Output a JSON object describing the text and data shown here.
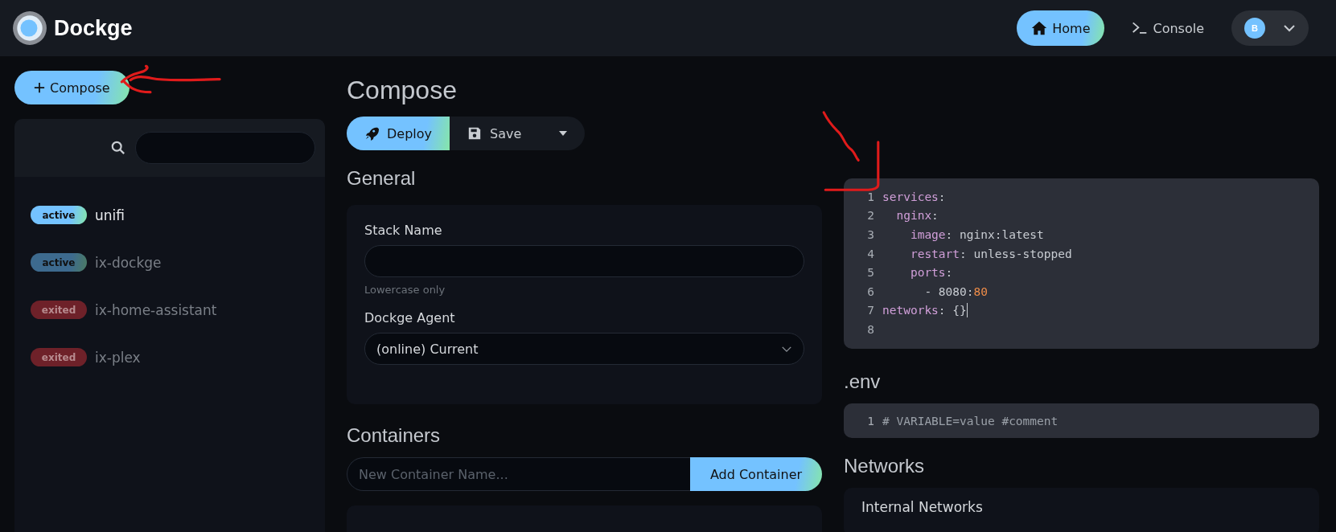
{
  "header": {
    "brand": "Dockge",
    "nav": [
      {
        "label": "Home",
        "selected": true
      },
      {
        "label": "Console",
        "selected": false
      }
    ],
    "profile": {
      "initial": "B"
    }
  },
  "sidebar": {
    "compose_button": "Compose",
    "stacks": [
      {
        "status": "active",
        "kind": "active",
        "name": "unifi",
        "dimmed": false
      },
      {
        "status": "active",
        "kind": "active",
        "name": "ix-dockge",
        "dimmed": true
      },
      {
        "status": "exited",
        "kind": "exited",
        "name": "ix-home-assistant",
        "dimmed": true
      },
      {
        "status": "exited",
        "kind": "exited",
        "name": "ix-plex",
        "dimmed": true
      }
    ]
  },
  "page": {
    "title": "Compose",
    "actions": {
      "deploy": "Deploy",
      "save": "Save"
    },
    "general": {
      "heading": "General",
      "stack_name": {
        "label": "Stack Name",
        "hint": "Lowercase only"
      },
      "agent": {
        "label": "Dockge Agent",
        "value": "(online) Current"
      }
    },
    "containers": {
      "heading": "Containers",
      "placeholder": "New Container Name...",
      "add_button": "Add Container"
    }
  },
  "editor": {
    "lines": [
      {
        "number": "1",
        "tokens": [
          {
            "t": "services",
            "kind": "key"
          },
          {
            "t": ":",
            "kind": "plain"
          }
        ]
      },
      {
        "number": "2",
        "tokens": [
          {
            "t": "  nginx",
            "kind": "key"
          },
          {
            "t": ":",
            "kind": "plain"
          }
        ]
      },
      {
        "number": "3",
        "tokens": [
          {
            "t": "    image",
            "kind": "key"
          },
          {
            "t": ": nginx:latest",
            "kind": "plain"
          }
        ]
      },
      {
        "number": "4",
        "tokens": [
          {
            "t": "    restart",
            "kind": "key"
          },
          {
            "t": ": unless-stopped",
            "kind": "plain"
          }
        ]
      },
      {
        "number": "5",
        "tokens": [
          {
            "t": "    ports",
            "kind": "key"
          },
          {
            "t": ":",
            "kind": "plain"
          }
        ]
      },
      {
        "number": "6",
        "tokens": [
          {
            "t": "      - 8080:",
            "kind": "plain"
          },
          {
            "t": "80",
            "kind": "number"
          }
        ]
      },
      {
        "number": "7",
        "cursor": true,
        "tokens": [
          {
            "t": "networks",
            "kind": "key"
          },
          {
            "t": ": {}",
            "kind": "plain"
          }
        ]
      },
      {
        "number": "8"
      }
    ]
  },
  "env": {
    "heading": ".env",
    "lines": [
      {
        "number": "1",
        "tokens": [
          {
            "t": "# VARIABLE=value #comment",
            "kind": "comment"
          }
        ]
      }
    ]
  },
  "networks": {
    "heading": "Networks",
    "subheading": "Internal Networks"
  }
}
